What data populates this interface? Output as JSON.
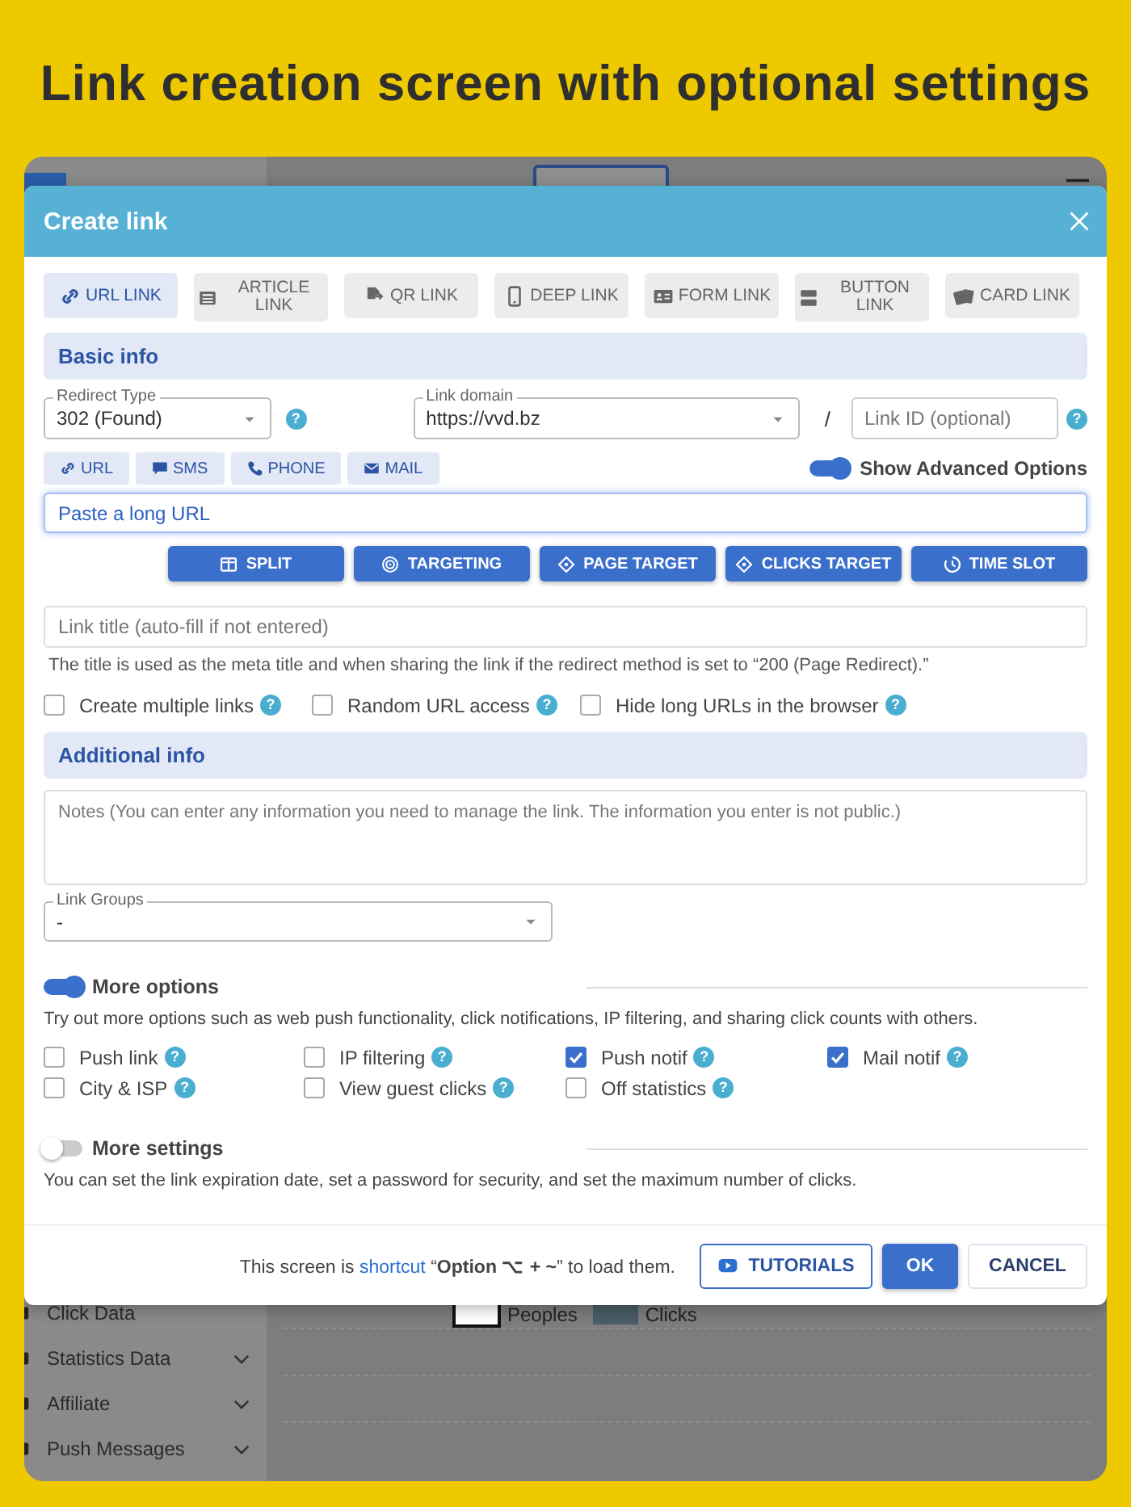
{
  "headline": "Link creation screen with optional settings",
  "background": {
    "sidebar_items": [
      {
        "label": "Click Data",
        "expandable": false
      },
      {
        "label": "Statistics Data",
        "expandable": true
      },
      {
        "label": "Affiliate",
        "expandable": true
      },
      {
        "label": "Push Messages",
        "expandable": true
      }
    ],
    "legend": [
      {
        "label": "Peoples",
        "color": "#ffffff"
      },
      {
        "label": "Clicks",
        "color": "#4a5e68"
      }
    ]
  },
  "dialog": {
    "title": "Create link",
    "link_types": [
      {
        "label": "URL LINK",
        "kind": "link",
        "selected": true
      },
      {
        "label": "ARTICLE LINK",
        "kind": "article",
        "selected": false
      },
      {
        "label": "QR LINK",
        "kind": "qr",
        "selected": false
      },
      {
        "label": "DEEP LINK",
        "kind": "deep",
        "selected": false
      },
      {
        "label": "FORM LINK",
        "kind": "form",
        "selected": false
      },
      {
        "label": "BUTTON LINK",
        "kind": "button",
        "selected": false
      },
      {
        "label": "CARD LINK",
        "kind": "card",
        "selected": false
      }
    ],
    "basic_info": {
      "heading": "Basic info",
      "redirect_type": {
        "label": "Redirect Type",
        "value": "302 (Found)",
        "help": "?"
      },
      "link_domain": {
        "label": "Link domain",
        "value": "https://vvd.bz"
      },
      "separator": "/",
      "link_id": {
        "placeholder": "Link ID (optional)",
        "help": "?"
      },
      "targets": [
        {
          "label": "URL",
          "kind": "url"
        },
        {
          "label": "SMS",
          "kind": "sms"
        },
        {
          "label": "PHONE",
          "kind": "phone"
        },
        {
          "label": "MAIL",
          "kind": "mail"
        }
      ],
      "advanced_toggle": {
        "label": "Show Advanced Options",
        "on": true
      },
      "url_field": {
        "placeholder": "Paste a long URL"
      },
      "actions": [
        {
          "label": "SPLIT",
          "kind": "split"
        },
        {
          "label": "TARGETING",
          "kind": "targeting"
        },
        {
          "label": "PAGE TARGET",
          "kind": "target"
        },
        {
          "label": "CLICKS TARGET",
          "kind": "target"
        },
        {
          "label": "TIME SLOT",
          "kind": "time"
        }
      ],
      "link_title": {
        "placeholder": "Link title (auto-fill if not entered)"
      },
      "hint": "The title is used as the meta title and when sharing the link if the redirect method is set to “200 (Page Redirect).”",
      "options": [
        {
          "label": "Create multiple links",
          "checked": false,
          "help": "?"
        },
        {
          "label": "Random URL access",
          "checked": false,
          "help": "?"
        },
        {
          "label": "Hide long URLs in the browser",
          "checked": false,
          "help": "?"
        }
      ]
    },
    "additional_info": {
      "heading": "Additional info",
      "notes": {
        "placeholder": "Notes (You can enter any information you need to manage the link. The information you enter is not public.)"
      },
      "link_groups": {
        "label": "Link Groups",
        "value": "-"
      },
      "more_options": {
        "label": "More options",
        "on": true,
        "description": "Try out more options such as web push functionality, click notifications, IP filtering, and sharing click counts with others.",
        "options": [
          {
            "label": "Push link",
            "checked": false,
            "help": "?"
          },
          {
            "label": "IP filtering",
            "checked": false,
            "help": "?"
          },
          {
            "label": "Push notif",
            "checked": true,
            "help": "?"
          },
          {
            "label": "Mail notif",
            "checked": true,
            "help": "?"
          },
          {
            "label": "City & ISP",
            "checked": false,
            "help": "?"
          },
          {
            "label": "View guest clicks",
            "checked": false,
            "help": "?"
          },
          {
            "label": "Off statistics",
            "checked": false,
            "help": "?"
          }
        ]
      },
      "more_settings": {
        "label": "More settings",
        "on": false,
        "description": "You can set the link expiration date, set a password for security, and set the maximum number of clicks."
      }
    },
    "footer": {
      "note_start": "This screen is",
      "note_link": "shortcut",
      "note_end": "“**Option ⌥ + ~**” to load them.",
      "buttons": [
        {
          "label": "TUTORIALS",
          "kind": "outline"
        },
        {
          "label": "OK",
          "kind": "primary"
        },
        {
          "label": "CANCEL",
          "kind": "plain"
        }
      ]
    }
  }
}
